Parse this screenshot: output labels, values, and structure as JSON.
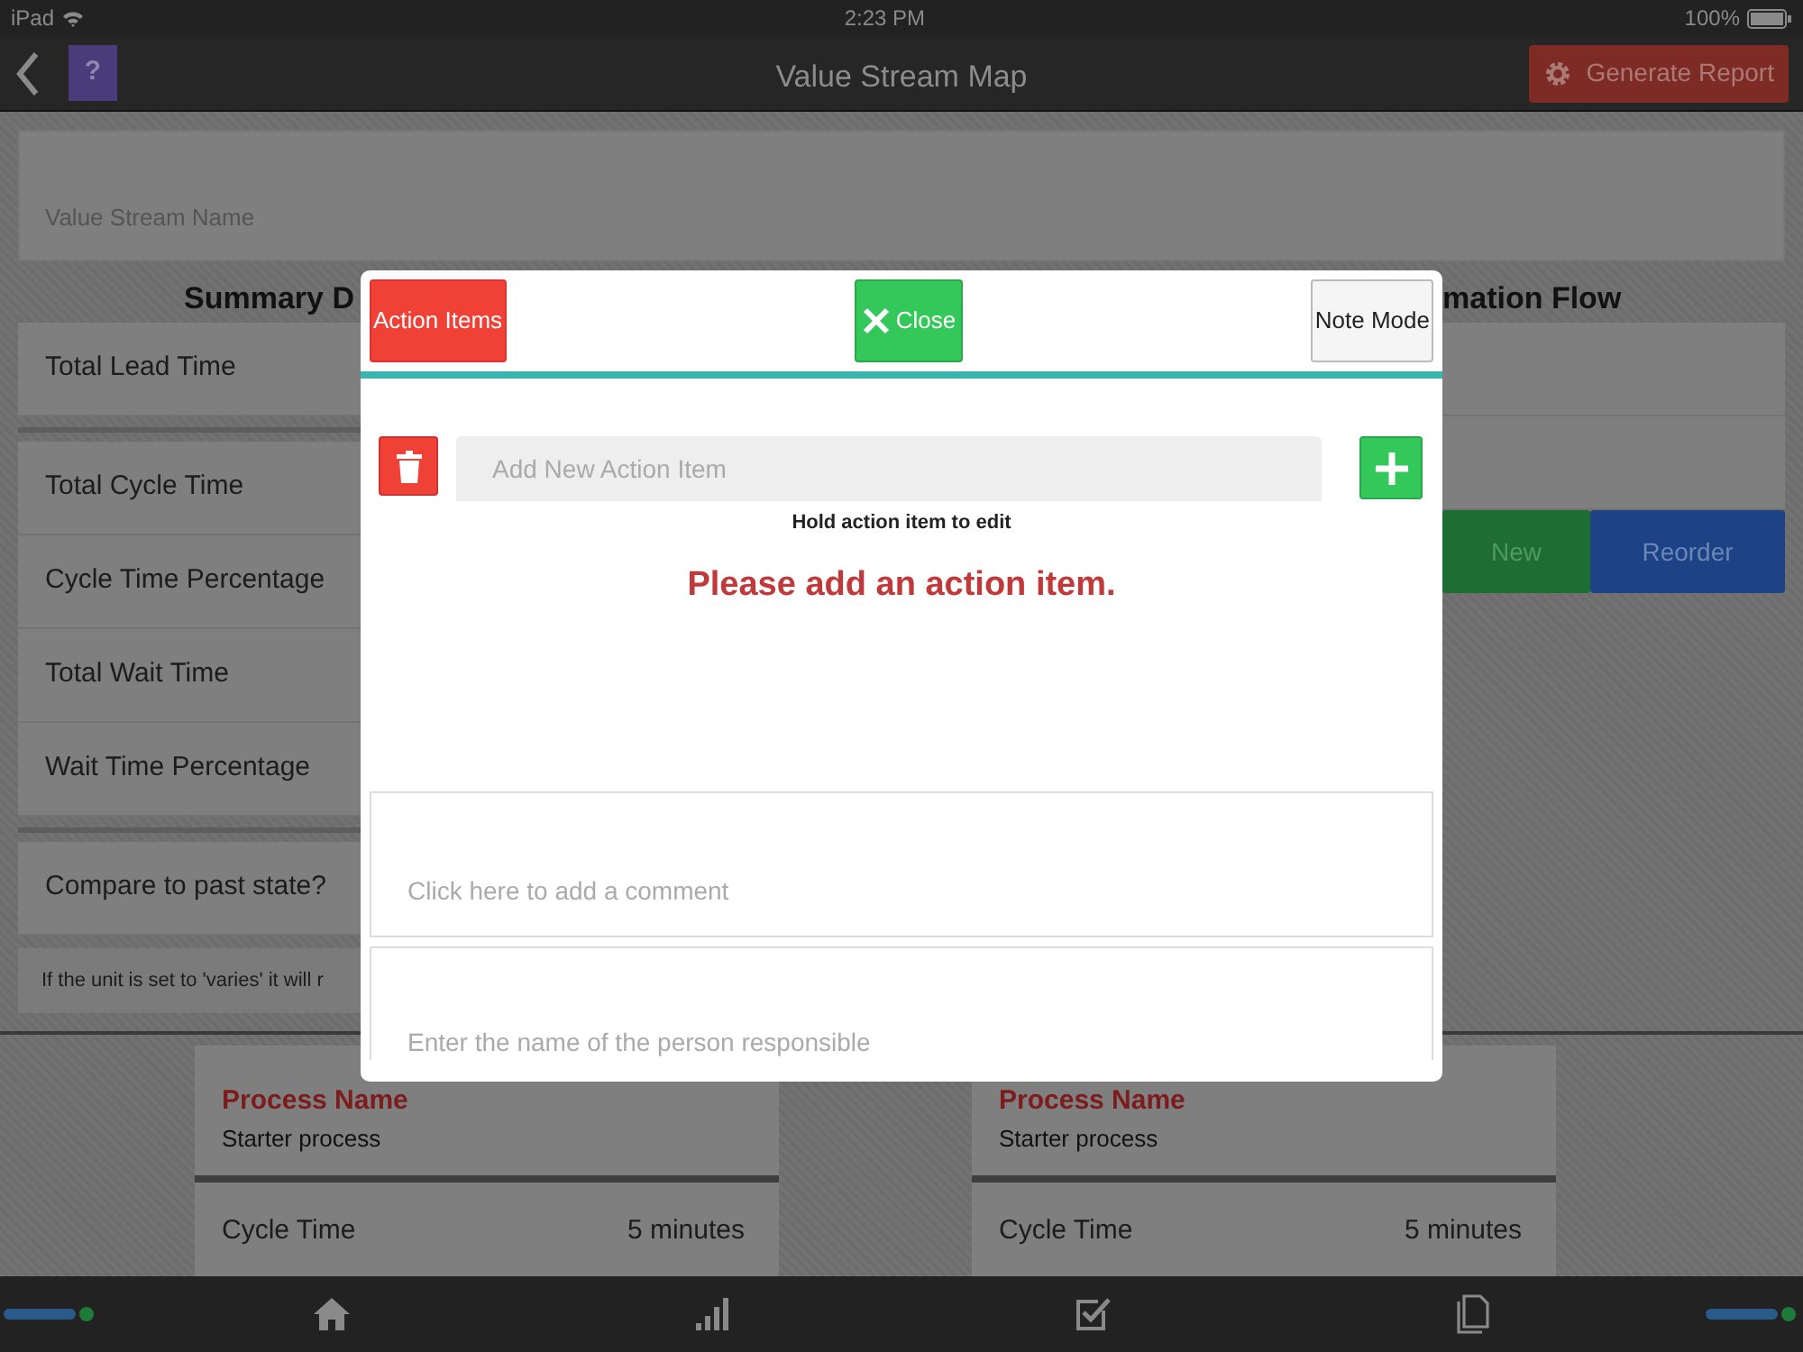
{
  "status_bar": {
    "carrier": "iPad",
    "time": "2:23 PM",
    "battery": "100%"
  },
  "nav": {
    "help": "?",
    "title": "Value Stream Map",
    "report_button": "Generate Report"
  },
  "value_stream_name": {
    "placeholder": "Value Stream Name"
  },
  "summary": {
    "heading": "Summary D",
    "row_groups": [
      {
        "rows": [
          {
            "label": "Total Lead Time"
          }
        ]
      },
      {
        "rows": [
          {
            "label": "Total Cycle Time"
          },
          {
            "label": "Cycle Time Percentage"
          },
          {
            "label": "Total Wait Time"
          },
          {
            "label": "Wait Time Percentage"
          }
        ]
      },
      {
        "rows": [
          {
            "label": "Compare to past state?"
          }
        ]
      }
    ],
    "note": "If the unit is set to 'varies' it will r"
  },
  "info_flow": {
    "heading": "mation Flow",
    "buttons": [
      {
        "label": "New",
        "kind": "new"
      },
      {
        "label": "Reorder",
        "kind": "reorder"
      }
    ]
  },
  "process_cards": [
    {
      "title": "Process Name",
      "name": "Starter process",
      "metric": "Cycle Time",
      "value": "5 minutes"
    },
    {
      "title": "Process Name",
      "name": "Starter process",
      "metric": "Cycle Time",
      "value": "5 minutes"
    }
  ],
  "modal": {
    "tabs": [
      {
        "label": "Action Items",
        "selected": true
      },
      {
        "label": "Note Mode",
        "selected": false
      }
    ],
    "close": "Close",
    "input_placeholder": "Add New Action Item",
    "hint": "Hold action item to edit",
    "empty_message": "Please add an action item.",
    "comment_placeholder": "Click here to add a comment",
    "responsible_placeholder": "Enter the name of the person responsible"
  },
  "tab_bar": [
    {
      "kind": "home"
    },
    {
      "kind": "chart"
    },
    {
      "kind": "check"
    },
    {
      "kind": "document"
    }
  ]
}
